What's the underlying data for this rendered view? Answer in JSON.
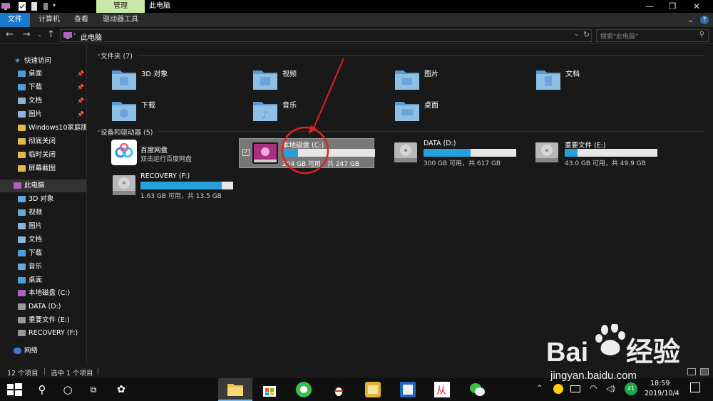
{
  "titlebar": {
    "manage_tab": "管理",
    "title": "此电脑",
    "minimize": "—",
    "restore": "❐",
    "close": "✕"
  },
  "ribbon": {
    "tabs": [
      "文件",
      "计算机",
      "查看",
      "驱动器工具"
    ],
    "expand_icon": "chevron-down-icon",
    "help_icon": "help-icon"
  },
  "address": {
    "path": "此电脑",
    "search_placeholder": "搜索\"此电脑\""
  },
  "sidebar": {
    "items": [
      {
        "label": "快速访问",
        "icon": "star-icon"
      },
      {
        "label": "桌面",
        "icon": "folder-icon",
        "pinned": true
      },
      {
        "label": "下载",
        "icon": "folder-icon",
        "pinned": true
      },
      {
        "label": "文档",
        "icon": "folder-icon",
        "pinned": true
      },
      {
        "label": "图片",
        "icon": "folder-icon",
        "pinned": true
      },
      {
        "label": "Windows10家庭版",
        "icon": "folder-icon"
      },
      {
        "label": "彻底关闭",
        "icon": "folder-icon"
      },
      {
        "label": "临时关闭",
        "icon": "folder-icon"
      },
      {
        "label": "屏幕截图",
        "icon": "folder-icon"
      },
      {
        "label": "此电脑",
        "icon": "computer-icon",
        "selected": true
      },
      {
        "label": "3D 对象",
        "icon": "folder-icon"
      },
      {
        "label": "视频",
        "icon": "folder-icon"
      },
      {
        "label": "图片",
        "icon": "folder-icon"
      },
      {
        "label": "文档",
        "icon": "folder-icon"
      },
      {
        "label": "下载",
        "icon": "folder-icon"
      },
      {
        "label": "音乐",
        "icon": "folder-icon"
      },
      {
        "label": "桌面",
        "icon": "folder-icon"
      },
      {
        "label": "本地磁盘 (C:)",
        "icon": "drive-icon"
      },
      {
        "label": "DATA (D:)",
        "icon": "drive-icon"
      },
      {
        "label": "重要文件 (E:)",
        "icon": "drive-icon"
      },
      {
        "label": "RECOVERY (F:)",
        "icon": "drive-icon"
      },
      {
        "label": "网络",
        "icon": "network-icon"
      }
    ]
  },
  "content": {
    "folders_header": "文件夹 (7)",
    "folders": [
      {
        "label": "3D 对象"
      },
      {
        "label": "视频"
      },
      {
        "label": "图片"
      },
      {
        "label": "文档"
      },
      {
        "label": "下载"
      },
      {
        "label": "音乐"
      },
      {
        "label": "桌面"
      }
    ],
    "devices_header": "设备和驱动器 (5)",
    "baidu": {
      "name": "百度网盘",
      "desc": "双击运行百度网盘"
    },
    "drives": [
      {
        "name": "本地磁盘 (C:)",
        "space": "204 GB 可用，共 247 GB",
        "used_fraction": 0.17,
        "selected": true
      },
      {
        "name": "DATA (D:)",
        "space": "300 GB 可用，共 617 GB",
        "used_fraction": 0.51
      },
      {
        "name": "重要文件 (E:)",
        "space": "43.0 GB 可用，共 49.9 GB",
        "used_fraction": 0.14
      },
      {
        "name": "RECOVERY (F:)",
        "space": "1.63 GB 可用，共 13.5 GB",
        "used_fraction": 0.88
      }
    ]
  },
  "statusbar": {
    "count": "12 个项目",
    "selected": "选中 1 个项目"
  },
  "taskbar": {
    "time": "18:59",
    "date": "2019/10/4",
    "badge": "41",
    "tray_arrow": "^"
  },
  "watermark": {
    "url": "jingyan.baidu.com"
  },
  "colors": {
    "accent": "#1979ca",
    "bar_fill": "#26a0da",
    "annotation": "#e0231d"
  }
}
